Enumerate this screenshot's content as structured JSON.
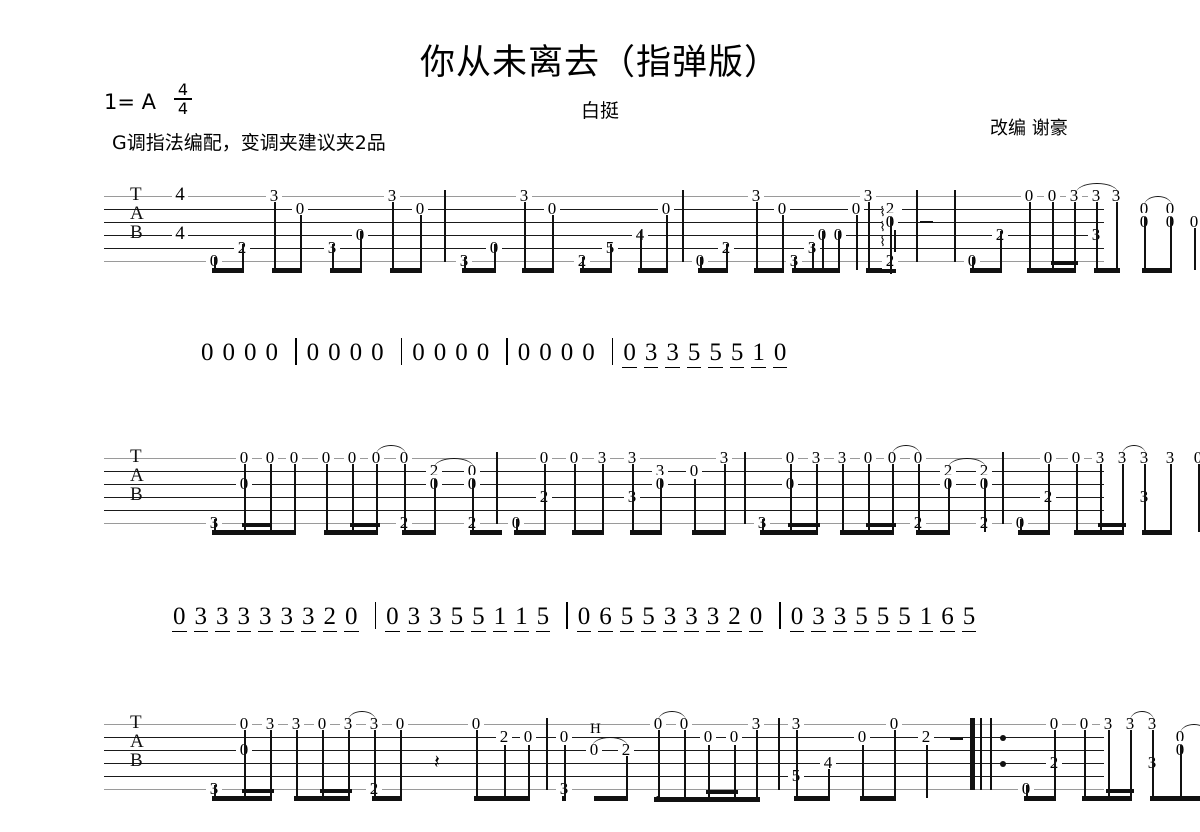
{
  "header": {
    "title": "你从未离去（指弹版）",
    "key_signature": "1= A",
    "meter_numerator": "4",
    "meter_denominator": "4",
    "artist": "白挺",
    "capo_note": "G调指法编配，变调夹建议夹2品",
    "arranger": "改编  谢豪"
  },
  "staff": {
    "label_top": "T",
    "label_mid": "A",
    "label_bottom": "B",
    "time_top": "4",
    "time_bottom": "4"
  },
  "systems": [
    {
      "name": "system-1",
      "measures": [
        {
          "name": "measure-1",
          "frets": [
            "0",
            "2",
            "3",
            "0",
            "3",
            "0",
            "3",
            "0",
            "3",
            "0"
          ]
        },
        {
          "name": "measure-2",
          "frets": [
            "3",
            "0",
            "3",
            "0",
            "2",
            "5",
            "4",
            "0"
          ]
        },
        {
          "name": "measure-3",
          "frets": [
            "0",
            "2",
            "3",
            "0",
            "3",
            "0",
            "3",
            "0"
          ]
        },
        {
          "name": "measure-4",
          "frets": [
            "3",
            "0",
            "0",
            "2",
            "0",
            "2",
            "-"
          ]
        },
        {
          "name": "measure-5",
          "frets": [
            "0",
            "2",
            "0",
            "0",
            "3",
            "3",
            "3",
            "3",
            "0",
            "0",
            "0",
            "0",
            "0"
          ]
        }
      ]
    },
    {
      "name": "system-2",
      "measures": [
        {
          "name": "measure-6",
          "frets": [
            "3",
            "0",
            "0",
            "0",
            "0",
            "0",
            "0",
            "0",
            "0",
            "2",
            "2",
            "0",
            "0",
            "2",
            "2"
          ]
        },
        {
          "name": "measure-7",
          "frets": [
            "0",
            "2",
            "0",
            "0",
            "3",
            "3",
            "3",
            "0",
            "0",
            "0",
            "0",
            "3"
          ]
        },
        {
          "name": "measure-8",
          "frets": [
            "3",
            "0",
            "0",
            "3",
            "3",
            "0",
            "0",
            "0",
            "2",
            "2",
            "0",
            "2",
            "0",
            "2"
          ]
        },
        {
          "name": "measure-9",
          "frets": [
            "0",
            "2",
            "0",
            "0",
            "3",
            "3",
            "3",
            "3",
            "0",
            "3",
            "0",
            "3"
          ]
        }
      ]
    },
    {
      "name": "system-3",
      "measures": [
        {
          "name": "measure-10",
          "frets": [
            "3",
            "0",
            "0",
            "3",
            "3",
            "0",
            "3",
            "3",
            "0",
            "2",
            "0",
            "2",
            "0",
            "2"
          ]
        },
        {
          "name": "measure-11",
          "frets": [
            "3",
            "0",
            "0",
            "2",
            "H",
            "0",
            "0",
            "0",
            "0",
            "3",
            "0",
            "0"
          ]
        },
        {
          "name": "measure-12",
          "frets": [
            "3",
            "5",
            "4",
            "0",
            "0",
            "2",
            "-"
          ]
        },
        {
          "name": "measure-13",
          "frets": [
            "0",
            "2",
            "0",
            "0",
            "3",
            "3",
            "3",
            "3",
            "0",
            "0",
            "0",
            "0",
            "0"
          ]
        }
      ]
    }
  ],
  "jianpu": [
    {
      "name": "jianpu-line-1",
      "measures": [
        {
          "notes": [
            "0",
            "0",
            "0",
            "0"
          ]
        },
        {
          "notes": [
            "0",
            "0",
            "0",
            "0"
          ]
        },
        {
          "notes": [
            "0",
            "0",
            "0",
            "0"
          ]
        },
        {
          "notes": [
            "0",
            "0",
            "0",
            "0"
          ]
        },
        {
          "notes": [
            "0",
            "3",
            "3",
            "5",
            "5",
            "5",
            "1",
            "0"
          ]
        }
      ]
    },
    {
      "name": "jianpu-line-2",
      "measures": [
        {
          "notes": [
            "0",
            "3",
            "3",
            "3",
            "3",
            "3",
            "3",
            "2",
            "0"
          ]
        },
        {
          "notes": [
            "0",
            "3",
            "3",
            "5",
            "5",
            "1",
            "1",
            "5"
          ]
        },
        {
          "notes": [
            "0",
            "6",
            "5",
            "5",
            "3",
            "3",
            "3",
            "2",
            "0"
          ]
        },
        {
          "notes": [
            "0",
            "3",
            "3",
            "5",
            "5",
            "5",
            "1",
            "6",
            "5"
          ]
        }
      ]
    }
  ],
  "symbols": {
    "hammer_on": "H",
    "rest_dash": "–",
    "rest_slash": "𝄽"
  }
}
